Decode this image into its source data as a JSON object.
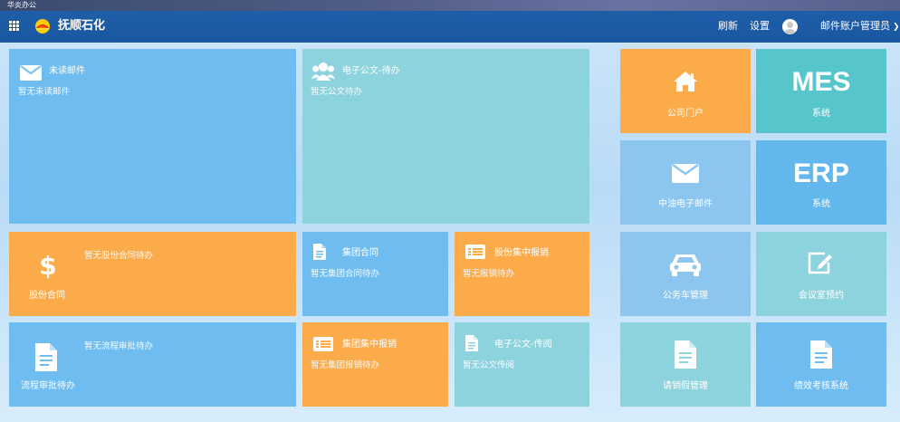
{
  "window": {
    "title": "华炎办公"
  },
  "header": {
    "brand": "抚顺石化",
    "refresh_label": "刷新",
    "settings_label": "设置",
    "user_label": "邮件账户管理员"
  },
  "tiles": {
    "unread_mail": {
      "title": "未读邮件",
      "sub": "暂无未读邮件"
    },
    "doc_pending": {
      "title": "电子公文-待办",
      "sub": "暂无公文待办"
    },
    "share_contract": {
      "label": "股份合同",
      "sub": "暂无股份合同待办"
    },
    "group_contract": {
      "title": "集团合同",
      "sub": "暂无集团合同待办"
    },
    "share_expense": {
      "title": "股份集中报销",
      "sub": "暂无报销待办"
    },
    "workflow": {
      "label": "流程审批待办",
      "sub": "暂无流程审批待办"
    },
    "group_expense": {
      "title": "集团集中报销",
      "sub": "暂无集团报销待办"
    },
    "doc_circulate": {
      "title": "电子公文-传阅",
      "sub": "暂无公文传阅"
    }
  },
  "apps": {
    "portal": {
      "label": "公司门户"
    },
    "mes": {
      "big": "MES",
      "label": "系统"
    },
    "mail": {
      "label": "中油电子邮件"
    },
    "erp": {
      "big": "ERP",
      "label": "系统"
    },
    "car": {
      "label": "公务车管理"
    },
    "meeting": {
      "label": "会议室预约"
    },
    "leave": {
      "label": "请销假管理"
    },
    "performance": {
      "label": "绩效考核系统"
    }
  },
  "colors": {
    "topbar": "#1e5ea8",
    "tile_blue": "#6fbdf0",
    "tile_teal": "#8dd3de",
    "tile_orange": "#fcab4a",
    "tile_lightblue": "#8cc6ef"
  },
  "icons": {
    "menu": "grid-icon",
    "logo": "petrochina-logo",
    "mail": "envelope-icon",
    "users": "users-icon",
    "dollar": "dollar-icon",
    "document": "document-icon",
    "list": "list-icon",
    "home": "home-icon",
    "car": "car-icon",
    "edit": "edit-icon",
    "avatar": "user-avatar"
  }
}
